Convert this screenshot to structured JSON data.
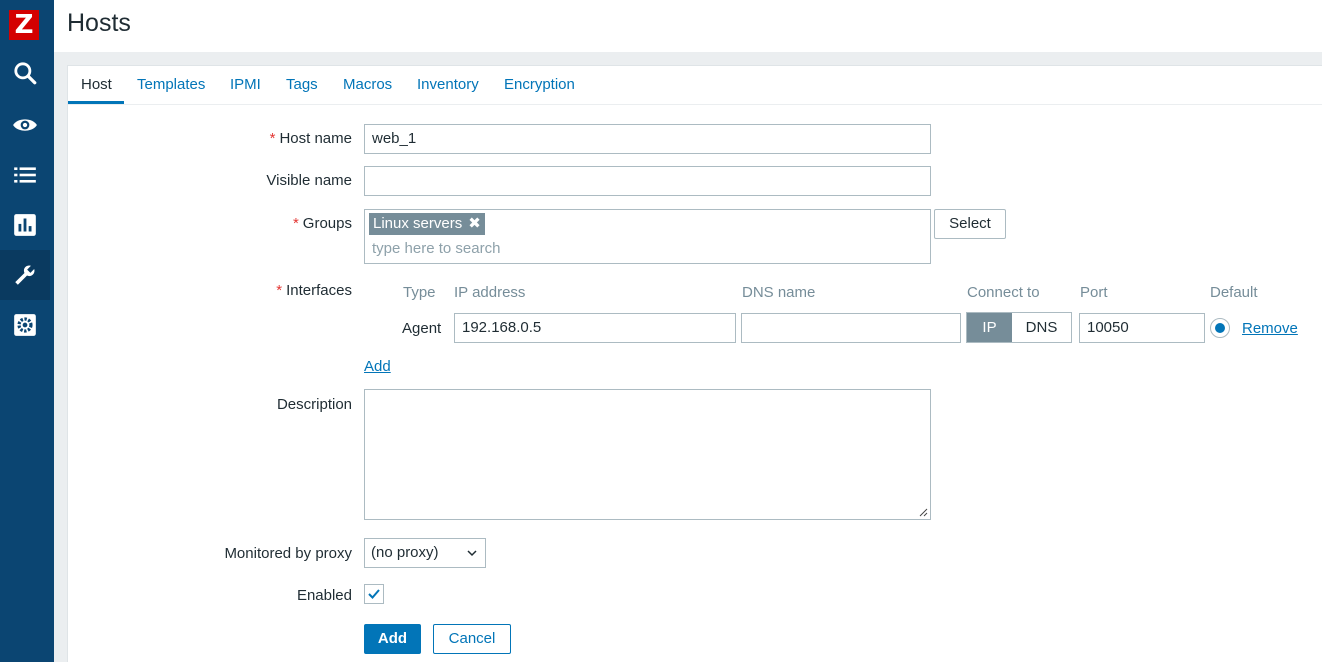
{
  "app": {
    "logo_letter": "Z"
  },
  "header": {
    "title": "Hosts"
  },
  "sidebar": {
    "items": [
      {
        "icon": "search-icon"
      },
      {
        "icon": "eye-icon"
      },
      {
        "icon": "list-icon"
      },
      {
        "icon": "bar-chart-icon"
      },
      {
        "icon": "wrench-icon",
        "active": true
      },
      {
        "icon": "gear-icon"
      }
    ]
  },
  "tabs": [
    {
      "label": "Host",
      "active": true
    },
    {
      "label": "Templates"
    },
    {
      "label": "IPMI"
    },
    {
      "label": "Tags"
    },
    {
      "label": "Macros"
    },
    {
      "label": "Inventory"
    },
    {
      "label": "Encryption"
    }
  ],
  "form": {
    "host_name_label": "Host name",
    "host_name_value": "web_1",
    "visible_name_label": "Visible name",
    "visible_name_value": "",
    "groups_label": "Groups",
    "groups_chip": "Linux servers",
    "groups_placeholder": "type here to search",
    "select_button": "Select",
    "interfaces_label": "Interfaces",
    "interfaces_columns": {
      "type": "Type",
      "ip": "IP address",
      "dns": "DNS name",
      "connect": "Connect to",
      "port": "Port",
      "default": "Default"
    },
    "interface_row": {
      "type": "Agent",
      "ip": "192.168.0.5",
      "dns": "",
      "connect_ip": "IP",
      "connect_dns": "DNS",
      "port": "10050",
      "remove": "Remove"
    },
    "add_link": "Add",
    "description_label": "Description",
    "proxy_label": "Monitored by proxy",
    "proxy_value": "(no proxy)",
    "enabled_label": "Enabled",
    "enabled": true,
    "add_button": "Add",
    "cancel_button": "Cancel"
  },
  "colors": {
    "sidebar": "#0b4572",
    "accent": "#0275b8",
    "logo": "#d40000",
    "required": "#e33734"
  }
}
